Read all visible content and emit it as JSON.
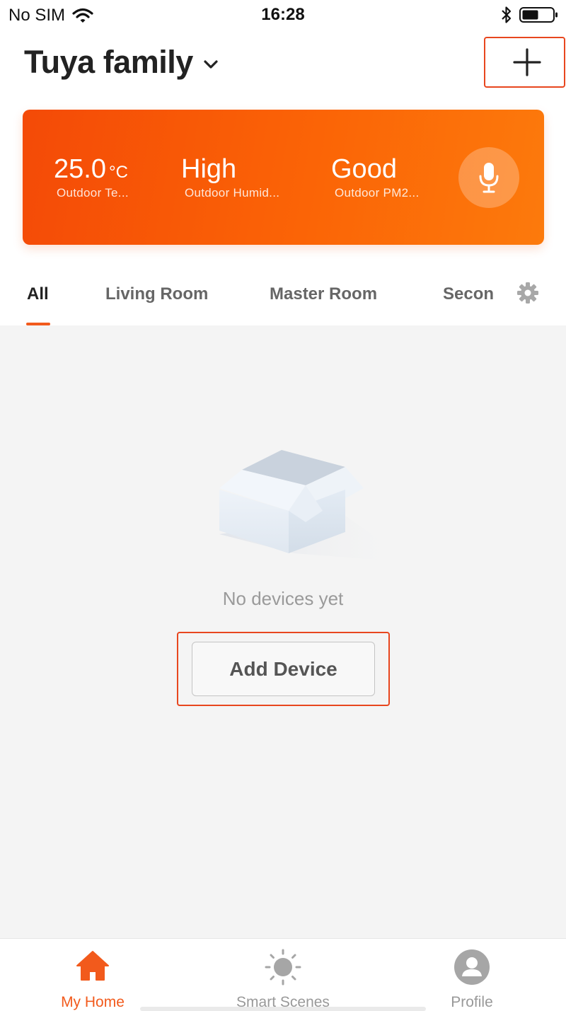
{
  "status_bar": {
    "carrier": "No SIM",
    "time": "16:28"
  },
  "header": {
    "title": "Tuya family"
  },
  "weather": {
    "temperature": {
      "value": "25.0",
      "unit": "°C",
      "label": "Outdoor Te..."
    },
    "humidity": {
      "value": "High",
      "label": "Outdoor Humid..."
    },
    "pm": {
      "value": "Good",
      "label": "Outdoor PM2..."
    }
  },
  "tabs": [
    {
      "label": "All",
      "active": true
    },
    {
      "label": "Living Room",
      "active": false
    },
    {
      "label": "Master Room",
      "active": false
    },
    {
      "label": "Secon",
      "active": false
    }
  ],
  "empty_state": {
    "message": "No devices yet",
    "button_label": "Add Device"
  },
  "bottom_nav": [
    {
      "label": "My Home",
      "icon": "home-icon",
      "active": true
    },
    {
      "label": "Smart Scenes",
      "icon": "sun-icon",
      "active": false
    },
    {
      "label": "Profile",
      "icon": "profile-icon",
      "active": false
    }
  ],
  "colors": {
    "accent": "#f25a1c",
    "card_start": "#f44a07",
    "card_end": "#fc7a0c",
    "highlight_frame": "#e8461e"
  }
}
